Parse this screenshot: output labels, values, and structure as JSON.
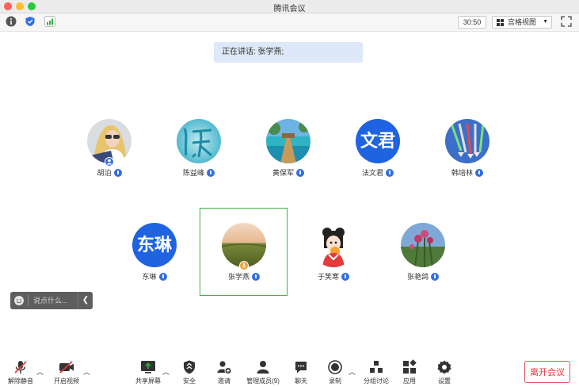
{
  "window": {
    "title": "腾讯会议"
  },
  "toolbar": {
    "timer": "30:50",
    "view_label": "宫格视图"
  },
  "speaking": {
    "text": "正在讲话: 张学燕;"
  },
  "participants": [
    {
      "name": "胡泊",
      "avatar_kind": "photo-woman",
      "host": true
    },
    {
      "name": "陈益峰",
      "avatar_kind": "photo-calligraphy"
    },
    {
      "name": "黄保军",
      "avatar_kind": "photo-pier"
    },
    {
      "name": "法文君",
      "avatar_kind": "text",
      "avatar_text": "文君"
    },
    {
      "name": "韩培林",
      "avatar_kind": "photo-jets"
    },
    {
      "name": "东琳",
      "avatar_kind": "text",
      "avatar_text": "东琳"
    },
    {
      "name": "张学燕",
      "avatar_kind": "photo-field",
      "active": true
    },
    {
      "name": "于笑寒",
      "avatar_kind": "photo-cartoon"
    },
    {
      "name": "张艳鸽",
      "avatar_kind": "photo-flowers"
    }
  ],
  "chat": {
    "placeholder": "说点什么..."
  },
  "bottom": {
    "unmute": "解除静音",
    "start_video": "开启视频",
    "share_screen": "共享屏幕",
    "security": "安全",
    "invite": "邀请",
    "members": "管理成员(9)",
    "chat": "聊天",
    "record": "录制",
    "breakout": "分组讨论",
    "apps": "应用",
    "settings": "设置",
    "leave": "离开会议"
  },
  "colors": {
    "accent": "#1f63e0",
    "active_border": "#3bb24a",
    "leave": "#e0353a"
  }
}
